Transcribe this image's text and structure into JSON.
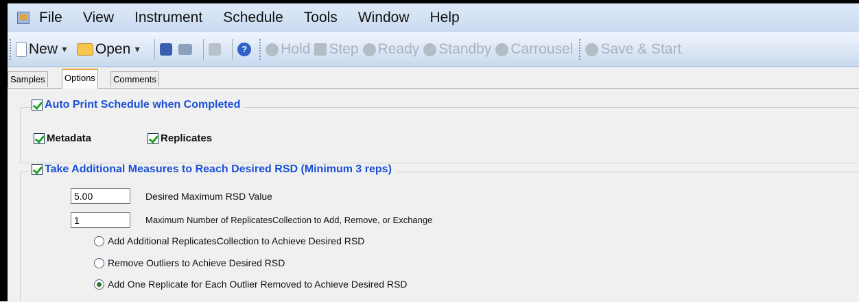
{
  "menu": {
    "items": [
      "File",
      "View",
      "Instrument",
      "Schedule",
      "Tools",
      "Window",
      "Help"
    ]
  },
  "toolbar": {
    "new_label": "New",
    "open_label": "Open",
    "hold_label": "Hold",
    "step_label": "Step",
    "ready_label": "Ready",
    "standby_label": "Standby",
    "carrousel_label": "Carrousel",
    "save_start_label": "Save & Start"
  },
  "tabs": [
    "Samples",
    "Options",
    "Comments"
  ],
  "auto_print": {
    "title": "Auto Print Schedule when Completed",
    "metadata_label": "Metadata",
    "replicates_label": "Replicates"
  },
  "rsd": {
    "title": "Take Additional Measures to Reach Desired RSD (Minimum 3 reps)",
    "max_rsd_value": "5.00",
    "max_rsd_label": "Desired Maximum RSD Value",
    "max_replicates_value": "1",
    "max_replicates_label": "Maximum Number of ReplicatesCollection to Add, Remove, or Exchange",
    "options": [
      "Add Additional ReplicatesCollection to Achieve Desired RSD",
      "Remove Outliers to Achieve Desired RSD",
      "Add One Replicate for Each Outlier Removed to Achieve Desired RSD"
    ],
    "selected_option": 2
  }
}
